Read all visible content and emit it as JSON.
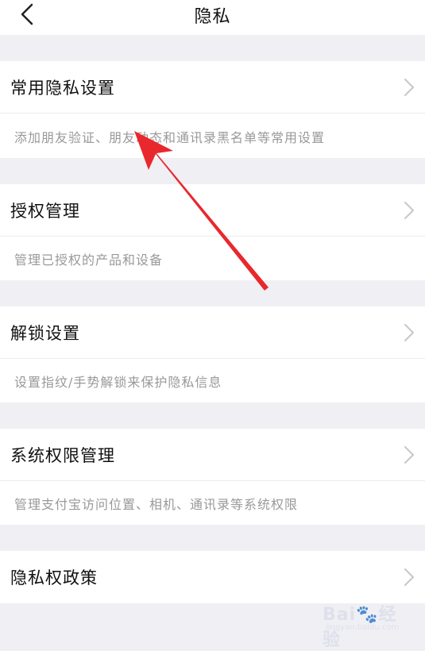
{
  "header": {
    "title": "隐私"
  },
  "sections": [
    {
      "label": "常用隐私设置",
      "desc": "添加朋友验证、朋友动态和通讯录黑名单等常用设置"
    },
    {
      "label": "授权管理",
      "desc": "管理已授权的产品和设备"
    },
    {
      "label": "解锁设置",
      "desc": "设置指纹/手势解锁来保护隐私信息"
    },
    {
      "label": "系统权限管理",
      "desc": "管理支付宝访问位置、相机、通讯录等系统权限"
    },
    {
      "label": "隐私权政策"
    }
  ],
  "annotation": {
    "arrow_color": "#e8282d"
  },
  "watermark": {
    "text": "Bai🐾经验",
    "sub": "jingyan.baidu.com"
  }
}
